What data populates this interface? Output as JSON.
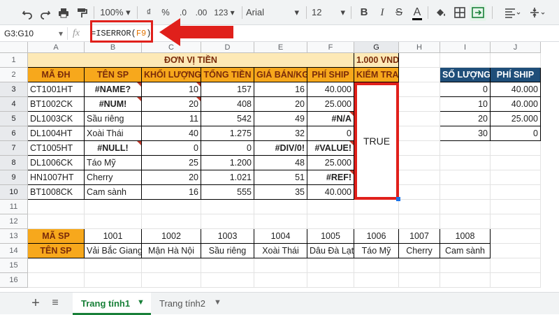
{
  "toolbar": {
    "zoom": "100%",
    "currency": "₫",
    "percent": "%",
    "decimal_decrease": ".0",
    "decimal_increase": ".00",
    "more_formats": "123",
    "font_name": "Arial",
    "font_size": "12",
    "bold": "B",
    "italic": "I",
    "strike": "S",
    "text_color": "A"
  },
  "formula_bar": {
    "name_box": "G3:G10",
    "fx": "fx",
    "formula_prefix": "=ISERROR(",
    "formula_ref": "F9",
    "formula_suffix": ")"
  },
  "columns": [
    "A",
    "B",
    "C",
    "D",
    "E",
    "F",
    "G",
    "H",
    "I",
    "J"
  ],
  "rows": [
    "1",
    "2",
    "3",
    "4",
    "5",
    "6",
    "7",
    "8",
    "9",
    "10",
    "11",
    "12",
    "13",
    "14",
    "15",
    "16"
  ],
  "header": {
    "unit_title": "ĐƠN VỊ TIỀN",
    "unit_value": "1.000 VND",
    "cols": [
      "MÃ ĐH",
      "TÊN SP",
      "KHỐI LƯỢNG",
      "TỔNG TIỀN",
      "GIÁ BÁN/KG",
      "PHÍ SHIP",
      "KIỂM TRA"
    ]
  },
  "orders": [
    [
      "CT1001HT",
      "#NAME?",
      "10",
      "157",
      "16",
      "40.000"
    ],
    [
      "BT1002CK",
      "#NUM!",
      "20",
      "408",
      "20",
      "25.000"
    ],
    [
      "DL1003CK",
      "Sầu riêng",
      "11",
      "542",
      "49",
      "#N/A"
    ],
    [
      "DL1004HT",
      "Xoài Thái",
      "40",
      "1.275",
      "32",
      "0"
    ],
    [
      "CT1005HT",
      "#NULL!",
      "0",
      "0",
      "#DIV/0!",
      "#VALUE!"
    ],
    [
      "DL1006CK",
      "Táo Mỹ",
      "25",
      "1.200",
      "48",
      "25.000"
    ],
    [
      "HN1007HT",
      "Cherry",
      "20",
      "1.021",
      "51",
      "#REF!"
    ],
    [
      "BT1008CK",
      "Cam sành",
      "16",
      "555",
      "35",
      "40.000"
    ]
  ],
  "check_result": "TRUE",
  "ship_table": {
    "headers": [
      "SỐ LƯỢNG",
      "PHÍ SHIP"
    ],
    "rows": [
      [
        "0",
        "40.000"
      ],
      [
        "10",
        "40.000"
      ],
      [
        "20",
        "25.000"
      ],
      [
        "30",
        "0"
      ]
    ]
  },
  "product_table": {
    "code_label": "MÃ SP",
    "name_label": "TÊN SP",
    "codes": [
      "1001",
      "1002",
      "1003",
      "1004",
      "1005",
      "1006",
      "1007",
      "1008"
    ],
    "names": [
      "Vải Bắc Giang",
      "Mận Hà Nội",
      "Sầu riêng",
      "Xoài Thái",
      "Dâu Đà Lạt",
      "Táo Mỹ",
      "Cherry",
      "Cam sành"
    ]
  },
  "sheets": {
    "add": "+",
    "list": "≡",
    "tab1": "Trang tính1",
    "tab2": "Trang tính2"
  },
  "colors": {
    "orange_header": "#f7a81c",
    "cream_header": "#fde9b6",
    "blue_header": "#1f4e79",
    "highlight_red": "#e0201b",
    "active_tab_green": "#188038"
  }
}
